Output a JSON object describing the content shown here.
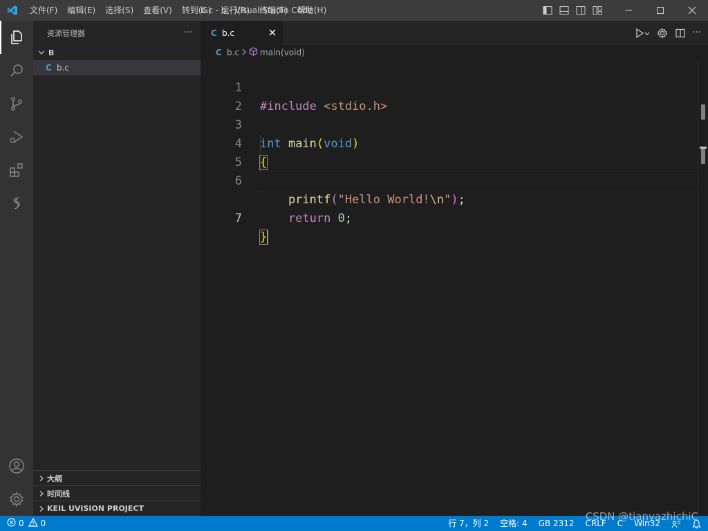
{
  "titlebar": {
    "menu": [
      "文件(F)",
      "编辑(E)",
      "选择(S)",
      "查看(V)",
      "转到(G)",
      "运行(R)",
      "终端(T)",
      "帮助(H)"
    ],
    "title": "b.c - b - Visual Studio Code"
  },
  "sidebar": {
    "header": "资源管理器",
    "more": "···",
    "folder": "B",
    "file": {
      "icon": "C",
      "name": "b.c"
    },
    "panels": [
      "大纲",
      "时间线",
      "KEIL UVISION PROJECT"
    ]
  },
  "editor": {
    "tab": {
      "icon": "C",
      "label": "b.c"
    },
    "breadcrumb": {
      "icon": "C",
      "file": "b.c",
      "symbol": "main(void)"
    },
    "line_numbers": [
      "1",
      "2",
      "3",
      "4",
      "5",
      "6",
      "7"
    ],
    "code": {
      "l1a": "#include",
      "l1b": " <stdio.h>",
      "l3a": "int",
      "l3b": " main",
      "l3c": "(",
      "l3d": "void",
      "l3e": ")",
      "l4": "{",
      "l5a": "    printf",
      "l5b": "(",
      "l5c": "\"Hello World!",
      "l5d": "\\n",
      "l5e": "\"",
      "l5f": ")",
      "l5g": ";",
      "l6a": "    return",
      "l6b": " 0",
      "l6c": ";",
      "l7": "}"
    }
  },
  "statusbar": {
    "errors": "0",
    "warnings": "0",
    "position": "行 7，列 2",
    "spaces": "空格: 4",
    "encoding": "GB 2312",
    "eol": "CRLF",
    "language": "C",
    "platform": "Win32"
  },
  "watermark": "CSDN @tianyazhichiC",
  "colors": {
    "accent": "#007acc",
    "titlebar": "#3c3c3c",
    "activitybar": "#333333",
    "sidebar": "#252526",
    "editor": "#1e1e1e",
    "vscode_logo": "#23a9f2"
  },
  "icons": [
    "vscode-logo",
    "explorer-icon",
    "search-icon",
    "source-control-icon",
    "run-debug-icon",
    "extensions-icon",
    "remote-icon",
    "account-icon",
    "settings-gear-icon",
    "close-icon",
    "run-icon",
    "split-editor-icon",
    "symbol-method-icon",
    "error-icon",
    "warning-icon",
    "feedback-icon",
    "bell-icon"
  ]
}
